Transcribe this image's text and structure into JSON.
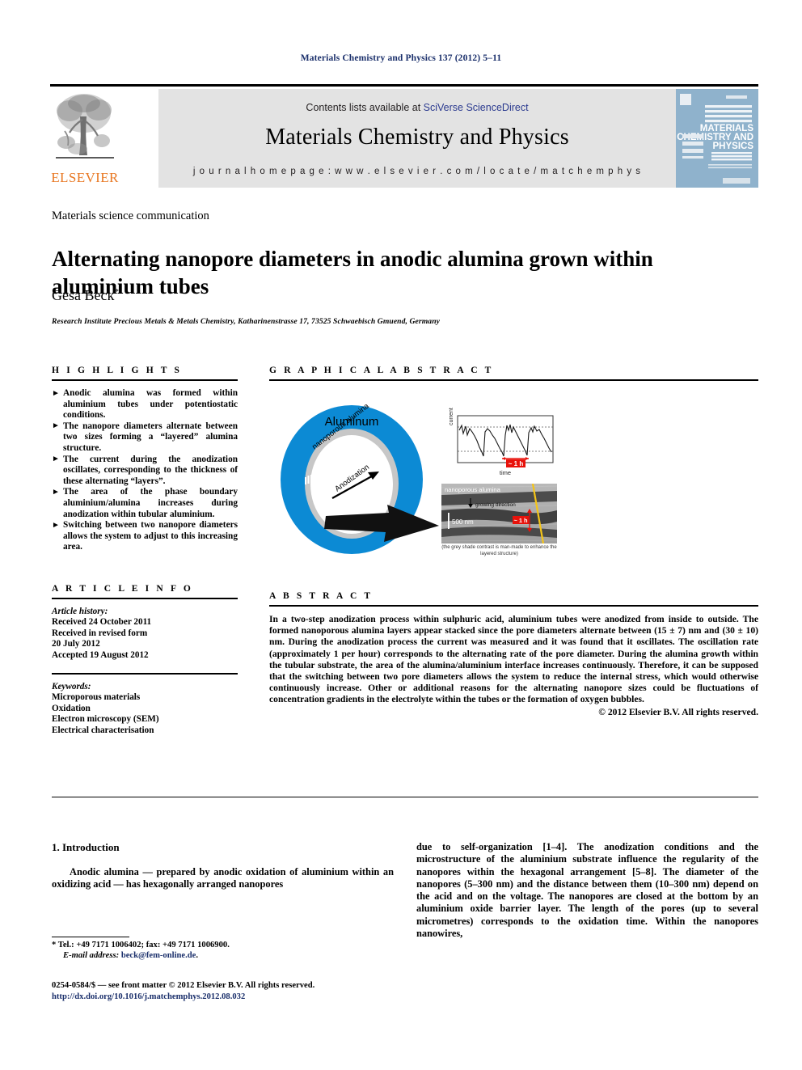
{
  "running_head": "Materials Chemistry and Physics 137 (2012) 5–11",
  "masthead": {
    "publisher_name": "ELSEVIER",
    "contents_prefix": "Contents lists available at ",
    "contents_link": "SciVerse ScienceDirect",
    "journal_title": "Materials Chemistry and Physics",
    "homepage_line": "j o u r n a l   h o m e p a g e :   w w w . e l s e v i e r . c o m / l o c a t e / m a t c h e m p h y s",
    "cover_title_lines": [
      "MATERIALS",
      "CHEMISTRY AND",
      "PHYSICS"
    ],
    "cover_bg": "#8fb2cc"
  },
  "article": {
    "section_type": "Materials science communication",
    "title": "Alternating nanopore diameters in anodic alumina grown within aluminium tubes",
    "author": "Gesa Beck",
    "author_marker": "*",
    "affiliation": "Research Institute Precious Metals & Metals Chemistry, Katharinenstrasse 17, 73525 Schwaebisch Gmuend, Germany"
  },
  "highlights": {
    "heading": "H I G H L I G H T S",
    "bullet_glyph": "►",
    "items": [
      "Anodic alumina was formed within aluminium tubes under potentiostatic conditions.",
      "The nanopore diameters alternate between two sizes forming a “layered” alumina structure.",
      "The current during the anodization oscillates, corresponding to the thickness of these alternating “layers”.",
      "The area of the phase boundary aluminium/alumina increases during anodization within tubular aluminium.",
      "Switching between two nanopore diameters allows the system to adjust to this increasing area."
    ]
  },
  "article_info": {
    "heading": "A R T I C L E   I N F O",
    "history_label": "Article history:",
    "history_lines": [
      "Received 24 October 2011",
      "Received in revised form",
      "20 July 2012",
      "Accepted 19 August 2012"
    ],
    "keywords_label": "Keywords:",
    "keywords": [
      "Microporous materials",
      "Oxidation",
      "Electron microscopy (SEM)",
      "Electrical characterisation"
    ]
  },
  "graphical_abstract": {
    "heading": "G R A P H I C A L   A B S T R A C T",
    "ring_outer_label": "Aluminum",
    "ring_inner_label": "nanoporous alumina",
    "arrow_label": "Anodization",
    "ring_color": "#0c8ad4",
    "alumina_ring_color": "#c7c7c7",
    "chart": {
      "ylabel": "current",
      "xlabel": "time",
      "annotation": "~ 1 h",
      "annotation_color": "#e8120b"
    },
    "sem": {
      "top_label": "nanoporous alumina",
      "growth_label": "growing direction",
      "scale_bar": "500 nm",
      "annotation": "~ 1 h",
      "annotation_color": "#e8120b",
      "note": "(the grey shade contrast is man-made to enhance the layered structure)"
    }
  },
  "abstract": {
    "heading": "A B S T R A C T",
    "text": "In a two-step anodization process within sulphuric acid, aluminium tubes were anodized from inside to outside. The formed nanoporous alumina layers appear stacked since the pore diameters alternate between (15 ± 7) nm and (30 ± 10) nm. During the anodization process the current was measured and it was found that it oscillates. The oscillation rate (approximately 1 per hour) corresponds to the alternating rate of the pore diameter. During the alumina growth within the tubular substrate, the area of the alumina/aluminium interface increases continuously. Therefore, it can be supposed that the switching between two pore diameters allows the system to reduce the internal stress, which would otherwise continuously increase. Other or additional reasons for the alternating nanopore sizes could be fluctuations of concentration gradients in the electrolyte within the tubes or the formation of oxygen bubbles.",
    "copyright": "© 2012 Elsevier B.V. All rights reserved."
  },
  "body": {
    "intro_heading": "1.  Introduction",
    "left_paragraph_part1": "Anodic alumina — prepared by anodic oxidation of aluminium within an oxidizing acid — has hexagonally arranged nanopores",
    "right_paragraph": "due to self-organization [1–4]. The anodization conditions and the microstructure of the aluminium substrate influence the regularity of the nanopores within the hexagonal arrangement [5–8]. The diameter of the nanopores (5–300 nm) and the distance between them (10–300 nm) depend on the acid and on the voltage. The nanopores are closed at the bottom by an aluminium oxide barrier layer. The length of the pores (up to several micrometres) corresponds to the oxidation time. Within the nanopores nanowires,",
    "refs": [
      "[1–4]",
      "[5–8]"
    ]
  },
  "footnote": {
    "marker": "*",
    "contact": "Tel.: +49 7171 1006402; fax: +49 7171 1006900.",
    "email_label": "E-mail address:",
    "email": "beck@fem-online.de",
    "email_trail": "."
  },
  "imprint": {
    "line1": "0254-0584/$ — see front matter © 2012 Elsevier B.V. All rights reserved.",
    "doi": "http://dx.doi.org/10.1016/j.matchemphys.2012.08.032"
  }
}
